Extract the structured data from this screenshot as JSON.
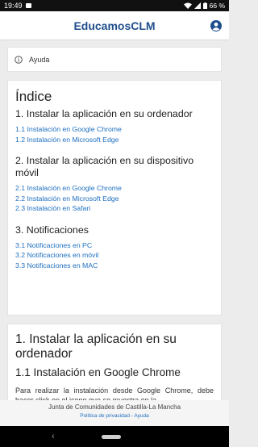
{
  "status": {
    "time": "19:49",
    "battery": "66 %"
  },
  "app": {
    "title": "EducamosCLM",
    "account_icon": "account-icon"
  },
  "help": {
    "label": "Ayuda",
    "icon": "info-icon"
  },
  "index": {
    "title": "Índice",
    "sections": [
      {
        "title": "1. Instalar la aplicación en su ordenador",
        "links": [
          "1.1 Instalación en Google Chrome",
          "1.2 Instalación en Microsoft Edge"
        ]
      },
      {
        "title": "2. Instalar la aplicación en su dispositivo móvil",
        "links": [
          "2.1 Instalación en Google Chrome",
          "2.2 Instalación en Microsoft Edge",
          "2.3 Instalación en Safari"
        ]
      },
      {
        "title": "3. Notificaciones",
        "links": [
          "3.1 Notificaciones en PC",
          "3.2 Notificaciones en móvil",
          "3.3 Notificaciones en MAC"
        ]
      }
    ]
  },
  "content": {
    "h1": "1. Instalar la aplicación en su ordenador",
    "h2": "1.1 Instalación en Google Chrome",
    "paragraph": "Para realizar la instalación desde Google Chrome, debe hacer click en el icono que se muestra en la"
  },
  "footer": {
    "org": "Junta de Comunidades de Castilla-La Mancha",
    "links": "Política de privacidad - Ayuda"
  },
  "colors": {
    "title": "#1f4e8c",
    "link": "#1e6fc0",
    "background": "#ececec"
  }
}
